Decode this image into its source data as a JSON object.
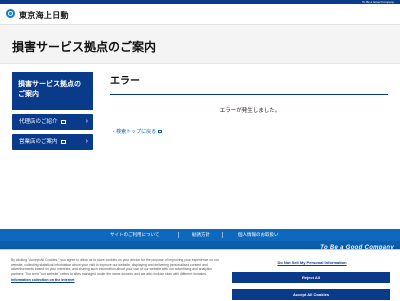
{
  "top_strip": {
    "tagline": "To Be a Good Company"
  },
  "header": {
    "logo_text": "東京海上日動"
  },
  "title": "損害サービス拠点のご案内",
  "sidebar": {
    "heading": "損害サービス拠点のご案内",
    "items": [
      {
        "label": "代理店のご紹介"
      },
      {
        "label": "営業店のご案内"
      }
    ]
  },
  "main": {
    "heading": "エラー",
    "message": "エラーが発生しました。",
    "back_link": "検索トップに戻る"
  },
  "footer": {
    "links": [
      {
        "label": "サイトのご利用について"
      },
      {
        "label": "勧誘方針"
      },
      {
        "label": "個人情報のお取扱い"
      }
    ],
    "tagline": "To Be a Good Company"
  },
  "cookie": {
    "text": "By clicking \"Accept All Cookies,\" you agree to allow us to store cookies on your device for the purpose of improving your experience on our website, collecting statistical information about your visit to improve our website, displaying and delivering personalized content and advertisements based on your interests, and sharing such information about your use of our website with our advertising and analytics partners. The term \"our website\" refers to sites managed under the same domain, and we also include sites with different domains.",
    "info_link": "Information collection on the Internet",
    "do_not_sell": "Do Not Sell My Personal Information",
    "reject_label": "Reject All",
    "accept_label": "Accept All Cookies"
  },
  "colors": {
    "brand_navy": "#0a3a8a",
    "footer_blue": "#0b5fae",
    "link_blue": "#0a5fb4"
  }
}
